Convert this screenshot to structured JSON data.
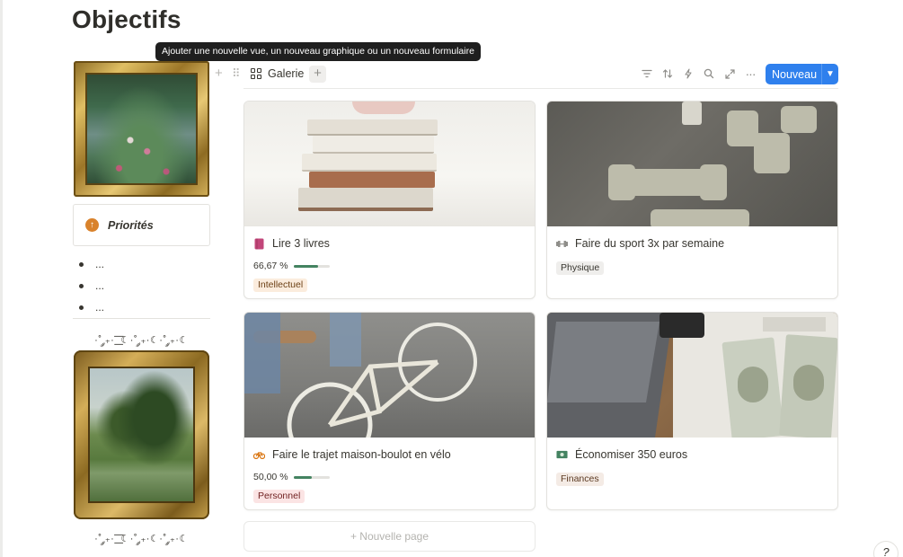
{
  "page": {
    "title": "Objectifs"
  },
  "tooltip": {
    "text": "Ajouter une nouvelle vue, un nouveau graphique ou un nouveau formulaire"
  },
  "sidebar": {
    "callout_icon": "arrow-up-circle-icon",
    "callout_text": "Priorités",
    "bullets": [
      "...",
      "...",
      "..."
    ],
    "ornament": "·˚ ༘₊· ͟͟͞͞ ☾·˚ ༘₊·☾·˚ ༘₊·☾"
  },
  "view": {
    "tab_label": "Galerie",
    "add_label": "+",
    "new_button": "Nouveau",
    "tools": [
      "filter-icon",
      "sort-icon",
      "lightning-icon",
      "search-icon",
      "expand-icon",
      "more-icon"
    ]
  },
  "cards": [
    {
      "title": "Lire 3 livres",
      "icon": "book-icon",
      "icon_color": "#c2467a",
      "progress_text": "66,67 %",
      "progress": 0.6667,
      "tag": "Intellectuel",
      "tag_bg": "#fbecdd",
      "tag_fg": "#6b3f14"
    },
    {
      "title": "Faire du sport 3x par semaine",
      "icon": "dumbbell-icon",
      "icon_color": "#8f8e8a",
      "tag": "Physique",
      "tag_bg": "#efeeec",
      "tag_fg": "#37352f"
    },
    {
      "title": "Faire le trajet maison-boulot en vélo",
      "icon": "bicycle-icon",
      "icon_color": "#d9730d",
      "progress_text": "50,00 %",
      "progress": 0.5,
      "tag": "Personnel",
      "tag_bg": "#fbe4e4",
      "tag_fg": "#6e1f1f"
    },
    {
      "title": "Économiser 350  euros",
      "icon": "banknote-icon",
      "icon_color": "#448361",
      "tag": "Finances",
      "tag_bg": "#f4ebe5",
      "tag_fg": "#5c3b23"
    }
  ],
  "new_page_label": "+ Nouvelle page",
  "help_icon": "help-icon"
}
